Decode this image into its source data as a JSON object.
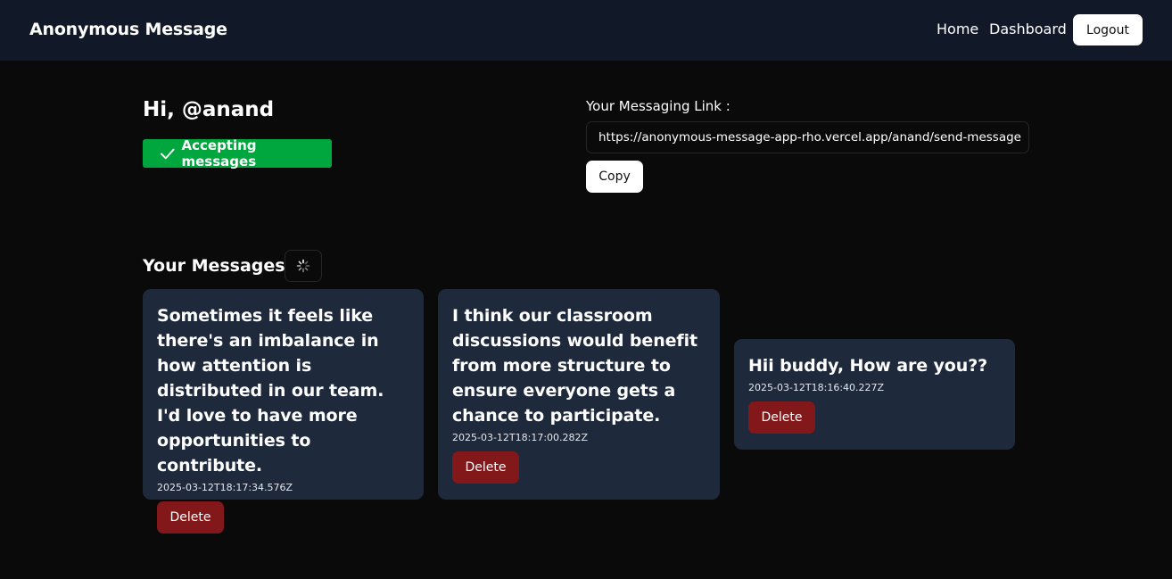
{
  "navbar": {
    "brand": "Anonymous Message",
    "links": [
      {
        "label": "Home"
      },
      {
        "label": "Dashboard"
      }
    ],
    "logout_label": "Logout"
  },
  "profile": {
    "greeting": "Hi, @anand",
    "accepting_label": "Accepting messages",
    "accepting_color": "#00a63e"
  },
  "link_section": {
    "label": "Your Messaging Link :",
    "url": "https://anonymous-message-app-rho.vercel.app/anand/send-message",
    "copy_label": "Copy"
  },
  "messages": {
    "heading": "Your Messages :",
    "refresh_icon": "loader-icon",
    "items": [
      {
        "text": "Sometimes it feels like there's an imbalance in how attention is distributed in our team. I'd love to have more opportunities to contribute.",
        "timestamp": "2025-03-12T18:17:34.576Z",
        "delete_label": "Delete"
      },
      {
        "text": "I think our classroom discussions would benefit from more structure to ensure everyone gets a chance to participate.",
        "timestamp": "2025-03-12T18:17:00.282Z",
        "delete_label": "Delete"
      },
      {
        "text": "Hii buddy, How are you??",
        "timestamp": "2025-03-12T18:16:40.227Z",
        "delete_label": "Delete"
      }
    ]
  },
  "colors": {
    "background": "#0a0a0a",
    "navbar": "#111827",
    "card": "#1e293b",
    "delete": "#82181a",
    "success": "#00a63e"
  }
}
